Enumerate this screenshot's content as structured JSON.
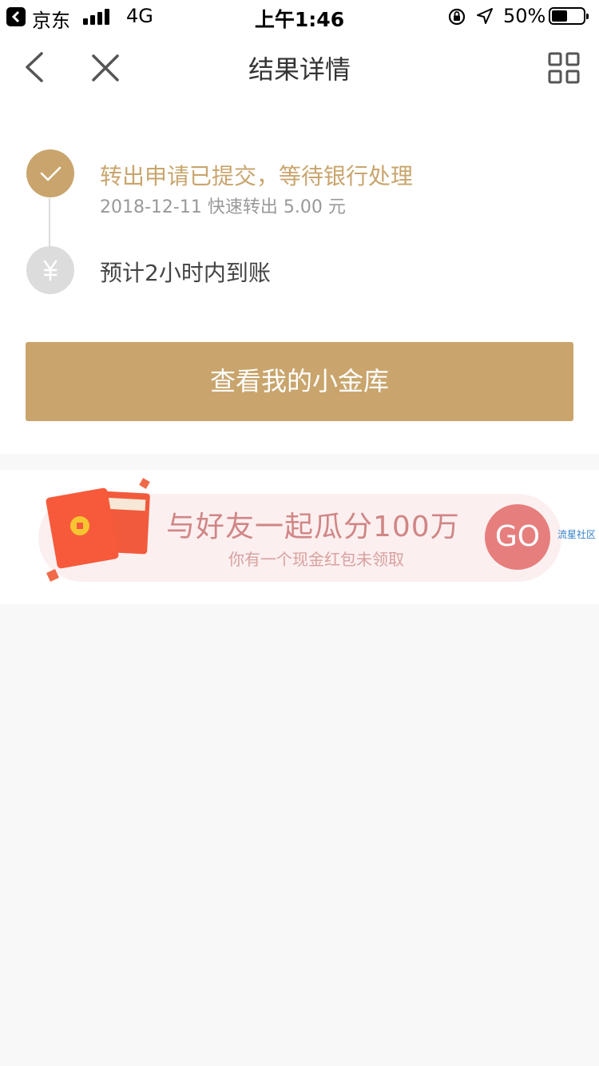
{
  "status_bar": {
    "carrier": "京东",
    "network": "4G",
    "time": "上午1:46",
    "battery_percent": "50%",
    "battery_level": 0.5,
    "icons": [
      "back-to-app-icon",
      "signal-icon",
      "rotation-lock-icon",
      "location-icon",
      "battery-icon"
    ]
  },
  "nav": {
    "title": "结果详情",
    "icons": [
      "chevron-left-icon",
      "close-icon",
      "grid-icon"
    ]
  },
  "steps": [
    {
      "title": "转出申请已提交，等待银行处理",
      "subtitle": "2018-12-11 快速转出 5.00 元",
      "status": "done",
      "icon": "check-icon"
    },
    {
      "title": "预计2小时内到账",
      "status": "pending",
      "icon": "yen-icon"
    }
  ],
  "primary_button": {
    "label": "查看我的小金库"
  },
  "promo": {
    "title": "与好友一起瓜分100万",
    "subtitle": "你有一个现金红包未领取",
    "go_label": "GO",
    "watermark": "流星社区"
  },
  "colors": {
    "accent_gold": "#c9a56d",
    "pending_gray": "#dcdcdc",
    "promo_red": "#e77e7e",
    "promo_bg": "#fcefef",
    "page_bg": "#f8f8f8"
  }
}
